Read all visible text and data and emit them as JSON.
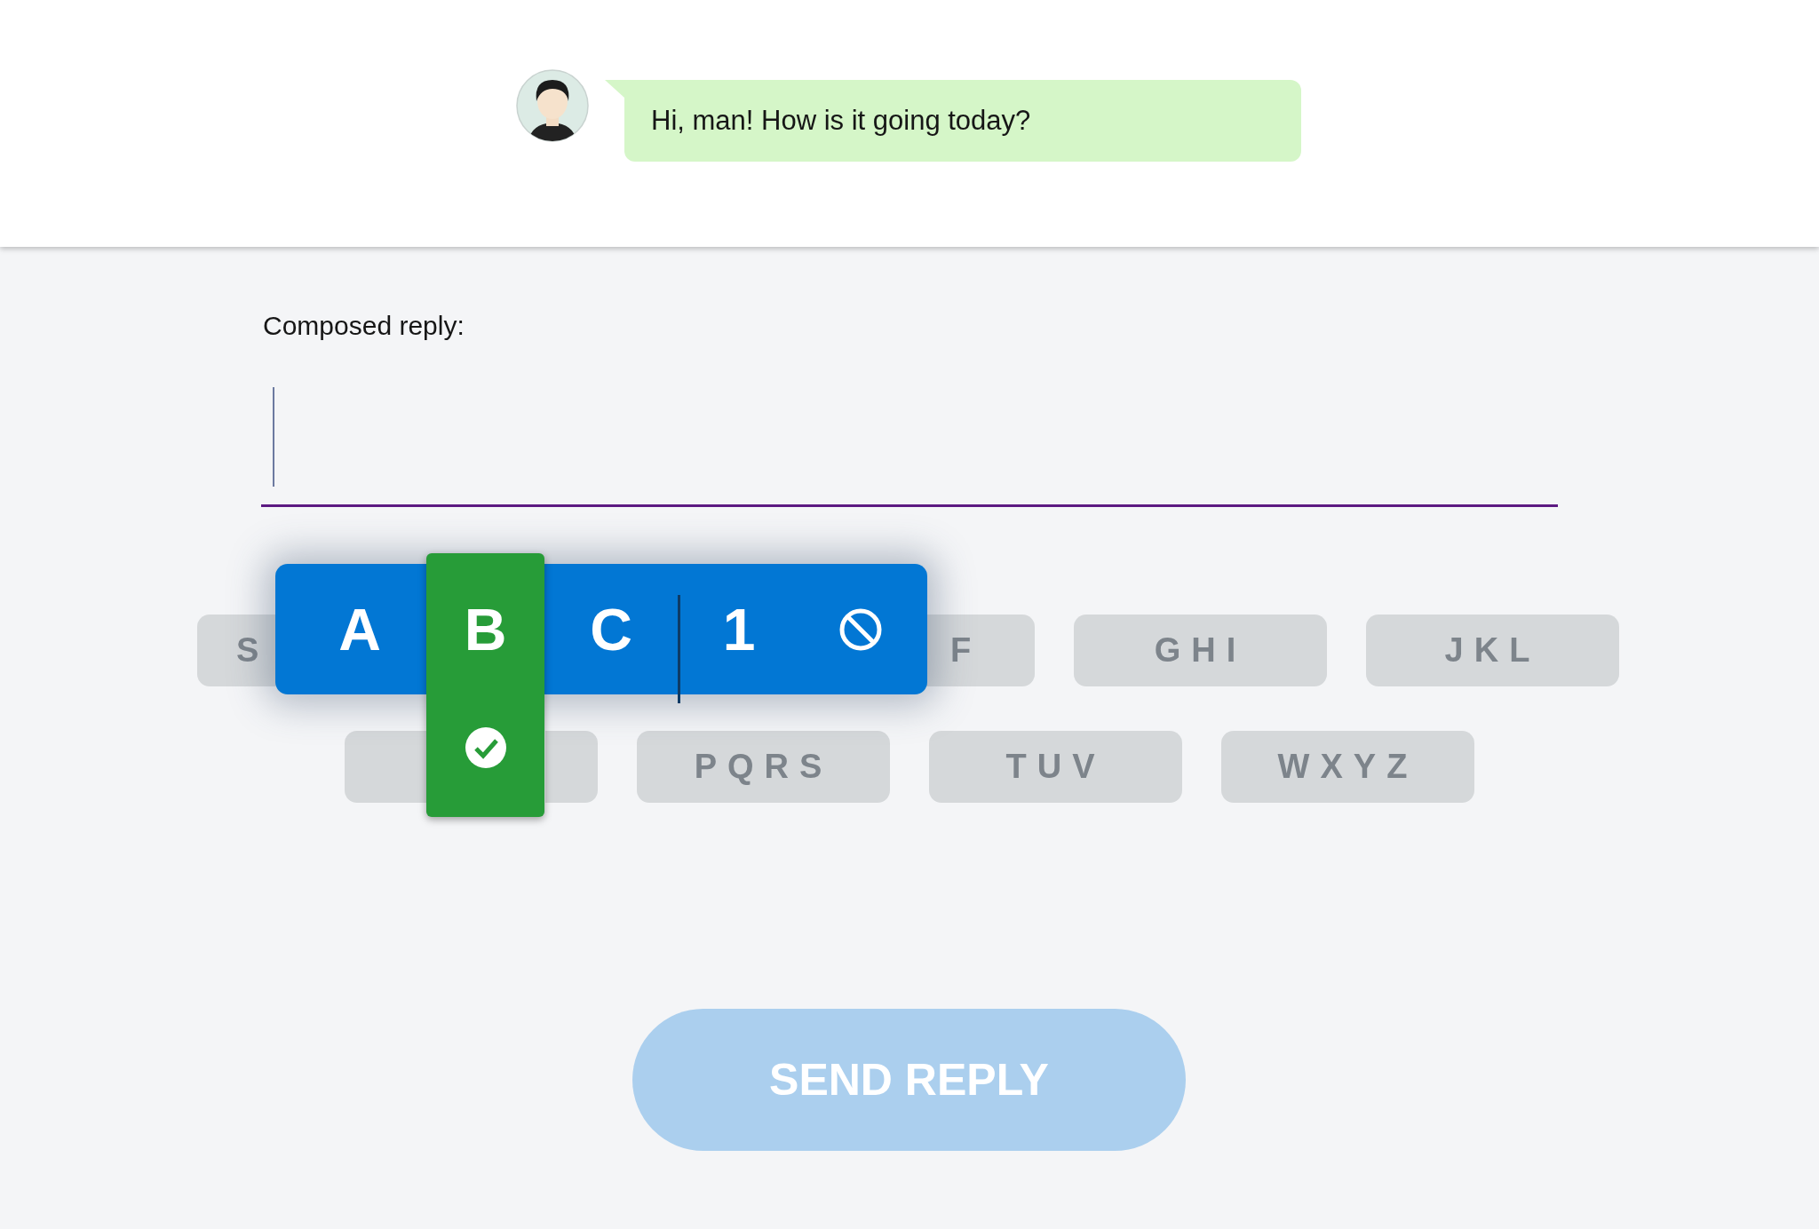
{
  "chat": {
    "message": "Hi, man! How is it going today?"
  },
  "composer": {
    "label": "Composed reply:"
  },
  "keypad": {
    "rows": [
      [
        {
          "label": "S"
        },
        {},
        {
          "label": "F"
        },
        {
          "label": "GHI"
        },
        {
          "label": "JKL"
        }
      ],
      [
        {},
        {
          "label": "PQRS"
        },
        {
          "label": "TUV"
        },
        {
          "label": "WXYZ"
        }
      ]
    ]
  },
  "popup": {
    "options": [
      {
        "kind": "letter",
        "label": "A",
        "selected": false
      },
      {
        "kind": "letter",
        "label": "B",
        "selected": true
      },
      {
        "kind": "letter",
        "label": "C",
        "selected": false
      },
      {
        "kind": "digit",
        "label": "1",
        "selected": false
      },
      {
        "kind": "cancel",
        "selected": false
      }
    ]
  },
  "send_button": {
    "label": "SEND REPLY",
    "disabled": true
  }
}
